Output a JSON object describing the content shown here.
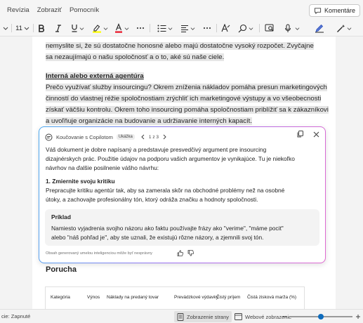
{
  "menu": {
    "items": [
      "Revízia",
      "Zobraziť",
      "Pomocník"
    ],
    "comments_label": "Komentáre"
  },
  "ribbon": {
    "font_size": "11"
  },
  "document": {
    "lines_top": [
      "nemyslite si, že sú dostatočne honosné alebo majú dostatočne vysoký rozpočet. Zvyčajne",
      "sa nezaujímajú o našu spoločnosť a o to, aké sú naše ciele."
    ],
    "heading": "Interná alebo externá agentúra",
    "lines_section": [
      "Prečo využívať služby insourcingu? Okrem zníženia nákladov pomáha presun marketingových",
      "činností do vlastnej réžie spoločnostiam zrýchliť ich marketingové výstupy a vo všeobecnosti",
      "získať väčšiu kontrolu. Okrem toho insourcing pomáha spoločnostiam priblížiť sa k zákazníkovi",
      "a uvoľňuje organizácie na budovanie a udržiavanie interných kapacít."
    ],
    "heading2": "Porucha",
    "table_headers": [
      "Kategória",
      "Výnos",
      "Náklady na predaný tovar",
      "Prevádzkové výdavky",
      "Čistý príjem",
      "Čistá zisková marža (%)"
    ]
  },
  "copilot": {
    "title": "Koučovanie s Copilotom",
    "badge": "Ukážka",
    "pager": "1 z 3",
    "intro": [
      "Váš dokument je dobre napísaný a predstavuje presvedčivý argument pre insourcing",
      "dizajnérskych prác. Použitie údajov na podporu vašich argumentov je vynikajúce. Tu je niekoľko",
      "návrhov na ďalšie posilnenie vášho návrhu:"
    ],
    "point_title": "1. Zmiernite svoju kritiku",
    "point_text": [
      "Prepracujte kritiku agentúr tak, aby sa zamerala skôr na obchodné problémy než na osobné",
      "útoky, a zachovajte profesionálny tón, ktorý odráža značku a hodnoty spoločnosti."
    ],
    "example_title": "Príklad",
    "example_text": [
      "Namiesto vyjadrenia svojho názoru ako faktu používajte frázy ako \"verime\", \"máme pocit\"",
      "alebo \"náš pohľad je\", aby ste uznali, že existujú rôzne názory, a zjemnili svoj tón."
    ],
    "disclaimer": "Obsah generovaný umelou inteligenciou môže byť nesprávny"
  },
  "status": {
    "accessibility": "cie: Zapnuté",
    "page_view": "Zobrazenie strany",
    "web_view": "Webové zobrazenie",
    "zoom_level": 0.5
  },
  "colors": {
    "highlight": "#ffff00",
    "font_color": "#e81123",
    "accent": "#0f6cbd"
  }
}
